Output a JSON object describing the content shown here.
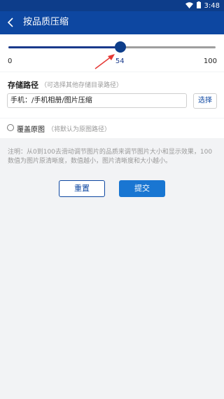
{
  "status_bar": {
    "time": "3:48"
  },
  "app_bar": {
    "title": "按品质压缩"
  },
  "quality_slider": {
    "min_label": "0",
    "max_label": "100",
    "value_label": "54",
    "value": 54,
    "min": 0,
    "max": 100
  },
  "storage_path": {
    "label": "存储路径",
    "hint": "（可选择其他存储目录路径）",
    "value": "手机：/手机相册/图片压缩",
    "choose_label": "选择"
  },
  "overwrite": {
    "label": "覆盖原图",
    "hint": "（将默认为原图路径）",
    "checked": false
  },
  "note": "注明：从0到100去滑动调节图片的品质来调节图片大小和显示效果，100数值为图片原清晰度，数值越小，图片清晰度和大小越小。",
  "actions": {
    "reset_label": "重置",
    "submit_label": "提交"
  },
  "colors": {
    "primary": "#0d47a1",
    "accent": "#1976d2",
    "annotation": "#e53935"
  }
}
